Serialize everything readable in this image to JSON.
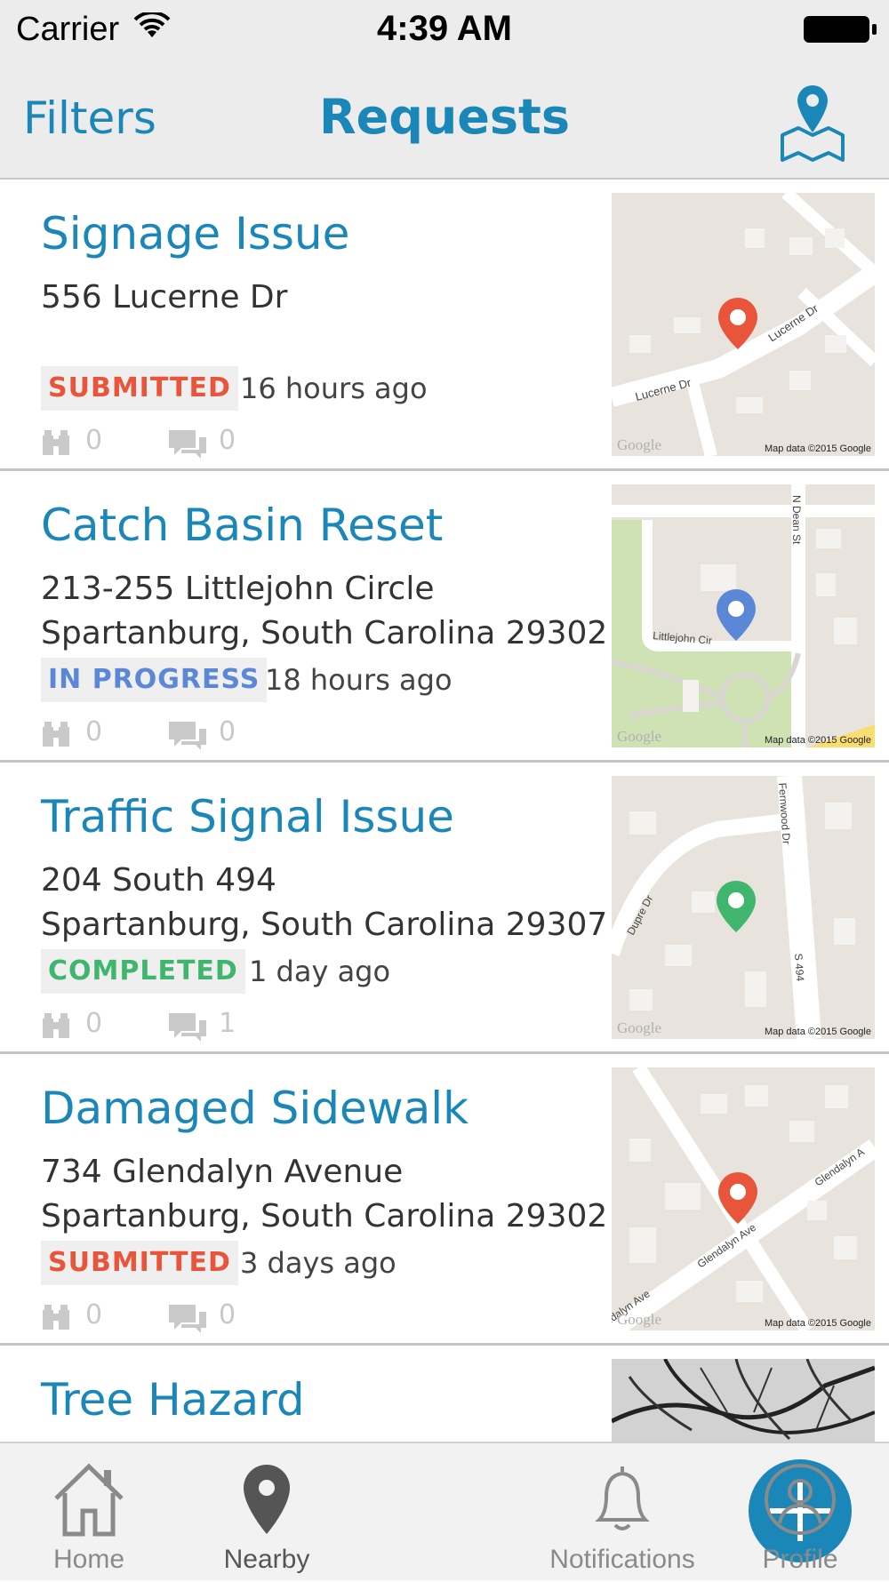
{
  "status_bar": {
    "carrier": "Carrier",
    "time": "4:39 AM"
  },
  "nav": {
    "left_label": "Filters",
    "title": "Requests",
    "right_icon": "map-pin-icon"
  },
  "colors": {
    "accent": "#1b87b8",
    "submitted": "#e8553a",
    "in_progress": "#5b88d6",
    "completed": "#3fb56d"
  },
  "requests": [
    {
      "title": "Signage Issue",
      "address1": "556  Lucerne Dr",
      "address2": "",
      "status": "SUBMITTED",
      "time": "16 hours ago",
      "follows": "0",
      "comments": "0",
      "map_credit": "Map data ©2015 Google",
      "map_logo": "Google",
      "streets": [
        "Lucerne Dr",
        "Lucerne Dr"
      ]
    },
    {
      "title": "Catch Basin Reset",
      "address1": "213-255  Littlejohn Circle",
      "address2": "Spartanburg, South Carolina 29302",
      "status": "IN PROGRESS",
      "time": "18 hours ago",
      "follows": "0",
      "comments": "0",
      "map_credit": "Map data ©2015 Google",
      "map_logo": "Google",
      "streets": [
        "Littlejohn Cir",
        "N Dean St"
      ]
    },
    {
      "title": "Traffic Signal Issue",
      "address1": "204  South 494",
      "address2": "Spartanburg, South Carolina 29307",
      "status": "COMPLETED",
      "time": "1 day ago",
      "follows": "0",
      "comments": "1",
      "map_credit": "Map data ©2015 Google",
      "map_logo": "Google",
      "streets": [
        "Dupre Dr",
        "Fernwood Dr",
        "S 494"
      ]
    },
    {
      "title": "Damaged Sidewalk",
      "address1": "734  Glendalyn Avenue",
      "address2": "Spartanburg, South Carolina 29302",
      "status": "SUBMITTED",
      "time": "3 days ago",
      "follows": "0",
      "comments": "0",
      "map_credit": "Map data ©2015 Google",
      "map_logo": "Google",
      "streets": [
        "Glendalyn Ave",
        "Glendalyn A",
        "ndalyn Ave"
      ]
    },
    {
      "title": "Tree Hazard"
    }
  ],
  "tabs": [
    {
      "label": "Home",
      "icon": "home-icon"
    },
    {
      "label": "Nearby",
      "icon": "location-pin-icon"
    },
    {
      "label": "",
      "icon": "plus-icon"
    },
    {
      "label": "Notifications",
      "icon": "bell-icon"
    },
    {
      "label": "Profile",
      "icon": "user-icon"
    }
  ]
}
